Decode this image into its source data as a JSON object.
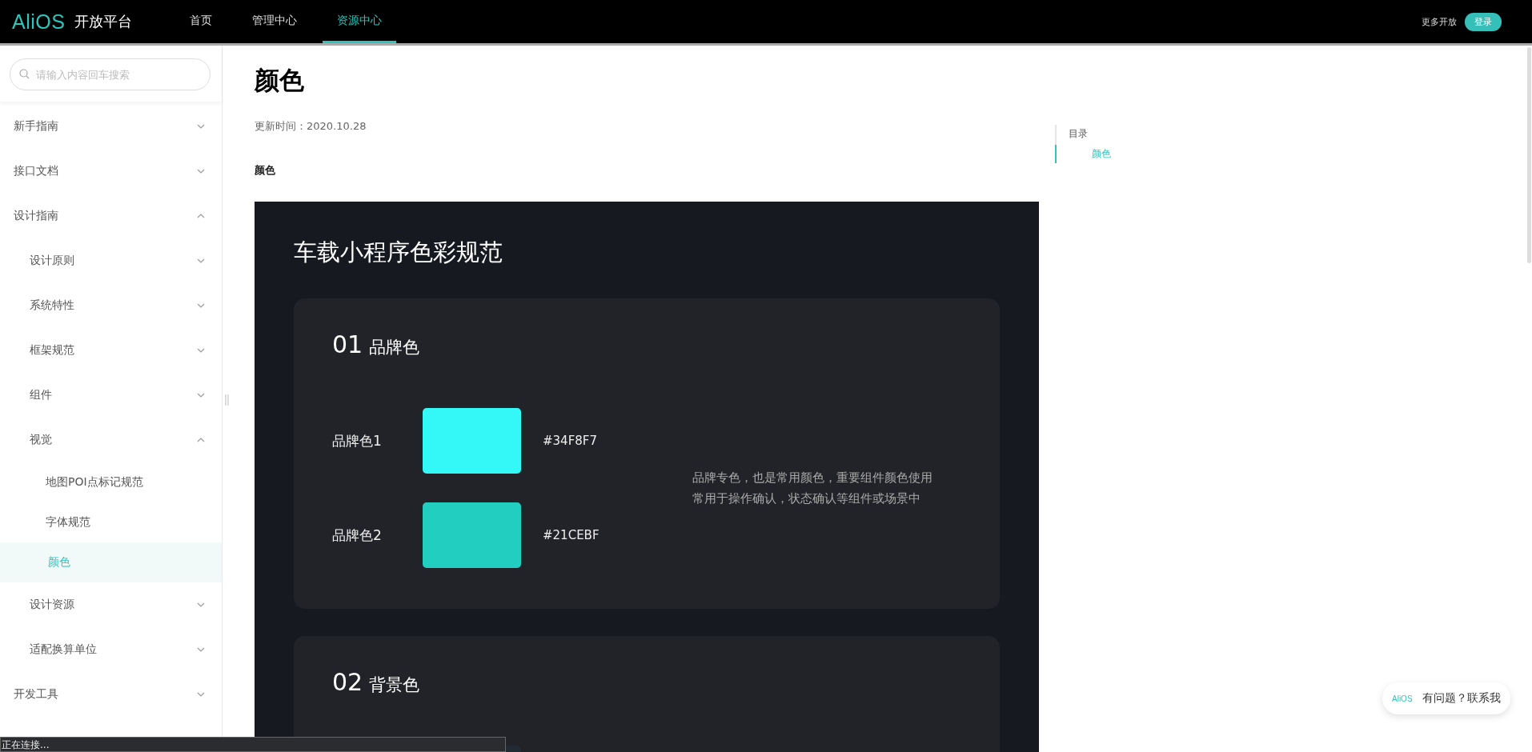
{
  "header": {
    "logo": "AliOS",
    "product": "开放平台",
    "nav": [
      {
        "label": "首页",
        "selected": false
      },
      {
        "label": "管理中心",
        "selected": false
      },
      {
        "label": "资源中心",
        "selected": true
      }
    ],
    "more": "更多开放",
    "login": "登录"
  },
  "sidebar": {
    "search": {
      "placeholder": "请输入内容回车搜索"
    },
    "items": [
      {
        "label": "新手指南",
        "kind": "group",
        "expanded": false
      },
      {
        "label": "接口文档",
        "kind": "group",
        "expanded": false
      },
      {
        "label": "设计指南",
        "kind": "group",
        "expanded": true,
        "children": [
          {
            "label": "设计原则",
            "kind": "group",
            "expanded": false
          },
          {
            "label": "系统特性",
            "kind": "group",
            "expanded": false
          },
          {
            "label": "框架规范",
            "kind": "group",
            "expanded": false
          },
          {
            "label": "组件",
            "kind": "group",
            "expanded": false
          },
          {
            "label": "视觉",
            "kind": "group",
            "expanded": true,
            "children": [
              {
                "label": "地图POI点标记规范",
                "kind": "page",
                "selected": false
              },
              {
                "label": "字体规范",
                "kind": "page",
                "selected": false
              },
              {
                "label": "颜色",
                "kind": "page",
                "selected": true
              }
            ]
          },
          {
            "label": "设计资源",
            "kind": "group",
            "expanded": false
          },
          {
            "label": "适配换算单位",
            "kind": "group",
            "expanded": false
          }
        ]
      },
      {
        "label": "开发工具",
        "kind": "group",
        "expanded": false
      }
    ]
  },
  "article": {
    "title": "颜色",
    "updated": "更新时间：2020.10.28",
    "section": "颜色",
    "document": {
      "title": "车载小程序色彩规范",
      "cards": [
        {
          "number": "01",
          "name": "品牌色",
          "description": [
            "品牌专色，也是常用颜色，重要组件颜色使用",
            "常用于操作确认，状态确认等组件或场景中"
          ],
          "swatches": [
            {
              "label": "品牌色1",
              "color": "#34f8f7",
              "hex": "#34F8F7"
            },
            {
              "label": "品牌色2",
              "color": "#21cebf",
              "hex": "#21CEBF"
            }
          ]
        },
        {
          "number": "02",
          "name": "背景色",
          "swatches": [
            {
              "color": "#222a33"
            }
          ]
        }
      ]
    }
  },
  "toc": {
    "title": "目录",
    "items": [
      {
        "label": "颜色",
        "selected": true
      }
    ]
  },
  "help": {
    "logo": "AliOS",
    "label": "有问题？联系我"
  },
  "status_bar": "正在连接..."
}
